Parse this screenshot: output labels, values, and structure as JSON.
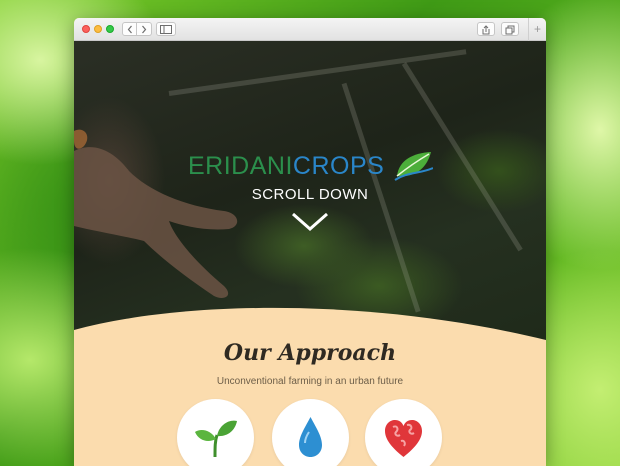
{
  "browser": {
    "buttons": {
      "back": "back",
      "forward": "forward",
      "sidebar": "sidebar",
      "share": "share",
      "tabs": "tabs",
      "new_tab": "+"
    }
  },
  "hero": {
    "logo_part1": "ERIDANI",
    "logo_part2": "CROPS",
    "scroll_label": "SCROLL DOWN"
  },
  "approach": {
    "title": "Our Approach",
    "subtitle": "Unconventional farming in an urban future",
    "icons": [
      "sprout-icon",
      "water-drop-icon",
      "heart-globe-icon"
    ]
  },
  "colors": {
    "logo_green": "#2b8f4c",
    "logo_blue": "#2a86c9",
    "section_bg": "#fbdcae"
  }
}
